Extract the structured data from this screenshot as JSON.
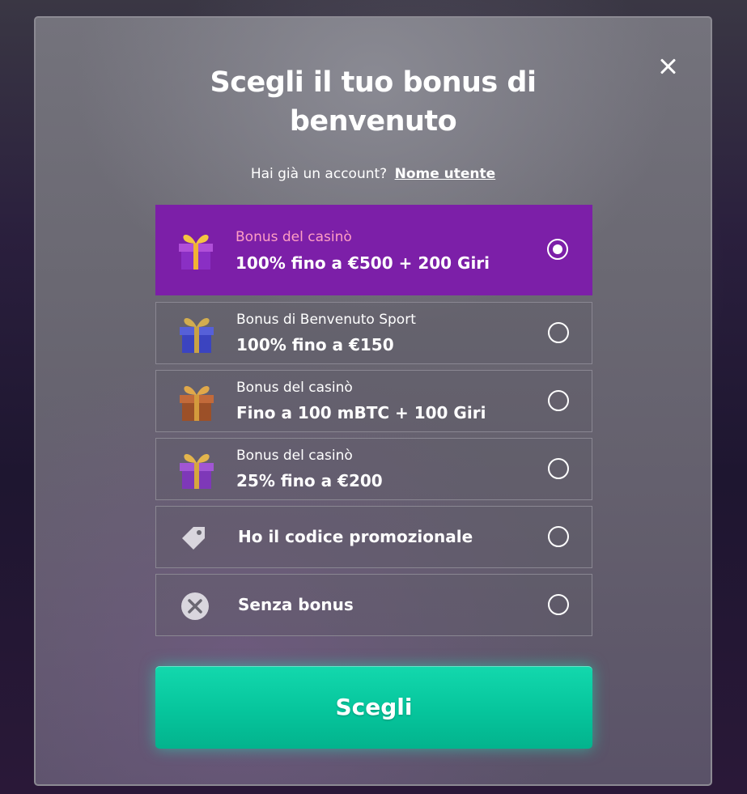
{
  "modal": {
    "title": "Scegli il tuo bonus di benvenuto",
    "account_prompt": "Hai già un account?",
    "account_link": "Nome utente",
    "close_icon": "close-icon"
  },
  "options": [
    {
      "subtitle": "Bonus del casinò",
      "title": "100% fino a €500 + 200 Giri",
      "icon": "gift-icon",
      "selected": true
    },
    {
      "subtitle": "Bonus di Benvenuto Sport",
      "title": "100% fino a €150",
      "icon": "gift-icon",
      "selected": false
    },
    {
      "subtitle": "Bonus del casinò",
      "title": "Fino a 100 mBTC + 100 Giri",
      "icon": "gift-icon",
      "selected": false
    },
    {
      "subtitle": "Bonus del casinò",
      "title": "25% fino a €200",
      "icon": "gift-icon",
      "selected": false
    },
    {
      "title": "Ho il codice promozionale",
      "icon": "tag-icon",
      "selected": false
    },
    {
      "title": "Senza bonus",
      "icon": "no-bonus-icon",
      "selected": false
    }
  ],
  "cta": {
    "label": "Scegli"
  },
  "colors": {
    "selected_bg": "#7c1fa8",
    "selected_subtitle": "#ff9ec4",
    "cta_bg": "#06c59c"
  }
}
